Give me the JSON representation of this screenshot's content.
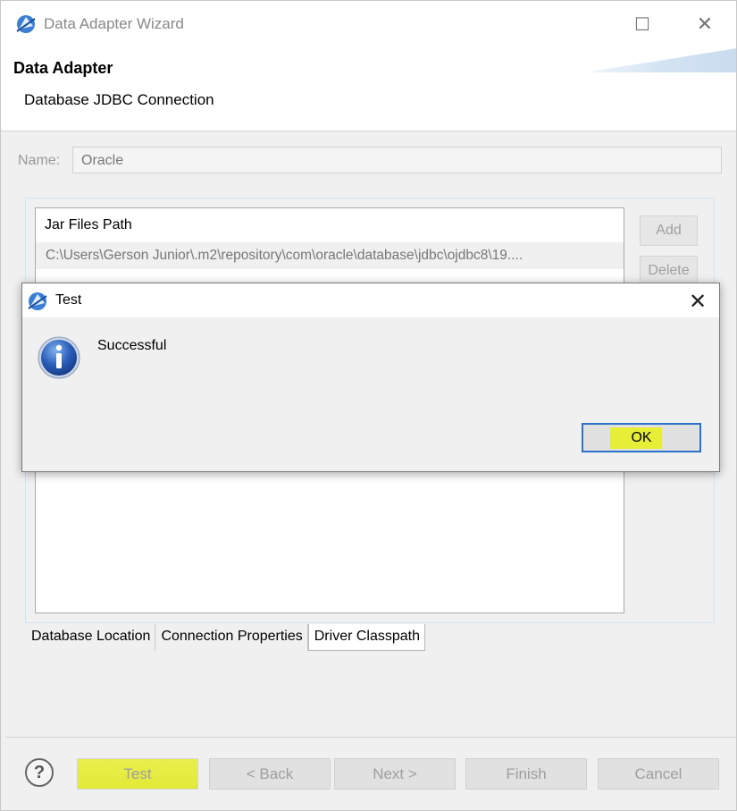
{
  "window": {
    "title": "Data Adapter Wizard",
    "maximize_glyph": "☐",
    "close_glyph": "✕"
  },
  "header": {
    "title": "Data Adapter",
    "subtitle": "Database JDBC Connection"
  },
  "name_field": {
    "label": "Name:",
    "value": "Oracle"
  },
  "jar_table": {
    "header": "Jar Files Path",
    "rows": [
      "C:\\Users\\Gerson Junior\\.m2\\repository\\com\\oracle\\database\\jdbc\\ojdbc8\\19...."
    ]
  },
  "side_buttons": {
    "add": "Add",
    "delete": "Delete"
  },
  "tabs": [
    {
      "label": "Database Location",
      "active": false
    },
    {
      "label": "Connection Properties",
      "active": false
    },
    {
      "label": "Driver Classpath",
      "active": true
    }
  ],
  "footer": {
    "help_glyph": "?",
    "test": "Test",
    "back": "< Back",
    "next": "Next >",
    "finish": "Finish",
    "cancel": "Cancel"
  },
  "dialog": {
    "title": "Test",
    "close_glyph": "✕",
    "message": "Successful",
    "ok": "OK"
  },
  "colors": {
    "highlight": "#e6ef35",
    "focus_border": "#2a73c9",
    "info_icon": "#2a5db8"
  },
  "icons": [
    "app-logo-icon",
    "maximize-icon",
    "close-icon",
    "help-icon",
    "info-icon"
  ]
}
